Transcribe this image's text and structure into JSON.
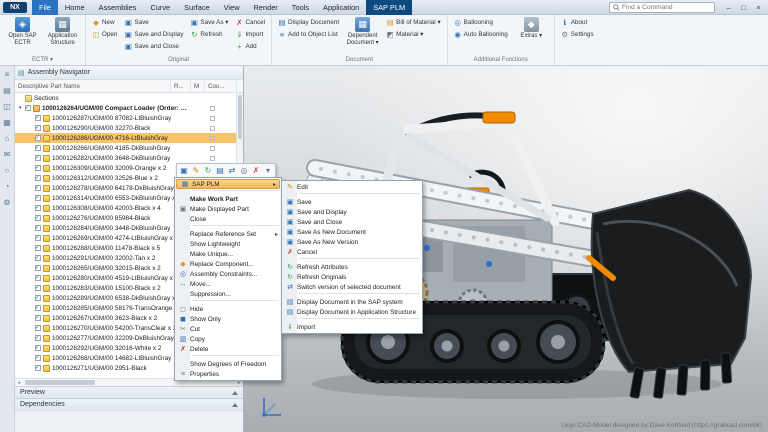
{
  "titlebar": {
    "logo": "NX",
    "search_placeholder": "Find a Command",
    "window_controls": {
      "minimize": "–",
      "restore": "□",
      "close": "×"
    },
    "tabs": [
      {
        "label": "File",
        "file": true
      },
      {
        "label": "Home"
      },
      {
        "label": "Assemblies"
      },
      {
        "label": "Curve"
      },
      {
        "label": "Surface"
      },
      {
        "label": "View"
      },
      {
        "label": "Render"
      },
      {
        "label": "Tools"
      },
      {
        "label": "Application"
      },
      {
        "label": "SAP PLM",
        "active": true
      }
    ]
  },
  "ribbon": {
    "groups": [
      {
        "label": "ECTR ▾"
      },
      {
        "label": "Original"
      },
      {
        "label": "Document"
      },
      {
        "label": "Additional Functions"
      },
      {
        "label": ""
      }
    ],
    "buttons": {
      "open_sap_ectr": "Open SAP ECTR",
      "application_structure": "Application Structure",
      "new": "New",
      "open": "Open",
      "save": "Save",
      "save_and_display": "Save and Display",
      "save_and_close": "Save and Close",
      "save_as": "Save As ▾",
      "refresh": "Refresh",
      "cancel": "Cancel",
      "import": "Import",
      "add": "Add",
      "display_document": "Display Document",
      "add_to_object_list": "Add to Object List",
      "dependent_document": "Dependent Document ▾",
      "bill_of_material": "Bill of Material ▾",
      "material": "Material ▾",
      "ballooning": "Ballooning",
      "auto_ballooning": "Auto Ballooning",
      "extras": "Extras ▾",
      "about": "About",
      "settings": "Settings"
    },
    "glyphs": {
      "open_sap_ectr": "◈",
      "application_structure": "▦",
      "dependent_document": "▦",
      "extras": "◆",
      "new": "◆",
      "open": "◫",
      "save": "▣",
      "save_and_display": "▣",
      "save_and_close": "▣",
      "save_as": "▣",
      "refresh": "↻",
      "cancel": "✗",
      "import": "⇓",
      "add": "+",
      "display_document": "▤",
      "add_to_object_list": "≡",
      "bill_of_material": "▤",
      "material": "◩",
      "ballooning": "◎",
      "auto_ballooning": "◉",
      "about": "ℹ",
      "settings": "⚙"
    }
  },
  "resource_bar": {
    "icons": [
      {
        "glyph": "≡",
        "name": "menu-icon"
      },
      {
        "glyph": "▤",
        "name": "assembly-navigator-icon"
      },
      {
        "glyph": "◫",
        "name": "constraint-navigator-icon"
      },
      {
        "glyph": "▦",
        "name": "part-navigator-icon"
      },
      {
        "glyph": "⌂",
        "name": "home-icon"
      },
      {
        "glyph": "✉",
        "name": "notes-icon"
      },
      {
        "glyph": "○",
        "name": "reuse-library-icon"
      },
      {
        "glyph": "◔",
        "name": "history-icon"
      },
      {
        "glyph": "⚙",
        "name": "roles-icon"
      }
    ]
  },
  "navigator": {
    "title": "Assembly Navigator",
    "columns": [
      "Descriptive Part Name",
      "R...",
      "M",
      "Cou..."
    ],
    "preview_label": "Preview",
    "dependencies_label": "Dependencies",
    "rows": [
      {
        "label": "Sections",
        "folder": true
      },
      {
        "label": "1000126264/UGM/00 Compact Loader (Order: C...",
        "asm": true,
        "bold": true,
        "exp": "▾",
        "chk": true
      },
      {
        "label": "1000126287/UGM/00 87082-LtBluishGray",
        "child": true,
        "chk": true
      },
      {
        "label": "1000126290/UGM/00 32270-Black",
        "child": true,
        "chk": true
      },
      {
        "label": "1000126286/UGM/00 4716-LtBluishGray",
        "child": true,
        "chk": true,
        "selected": true
      },
      {
        "label": "1000126266/UGM/00 4185-DkBluishGray",
        "child": true,
        "chk": true
      },
      {
        "label": "1000126282/UGM/00 3648-DkBluishGray",
        "child": true,
        "chk": true
      },
      {
        "label": "1000126309/UGM/00 32009-Orange x 2",
        "child": true,
        "chk": true
      },
      {
        "label": "1000126312/UGM/00 32526-Blue x 2",
        "child": true,
        "chk": true
      },
      {
        "label": "1000126278/UGM/00 64178-DkBluishGray x 2",
        "child": true,
        "chk": true
      },
      {
        "label": "1000126314/UGM/00 6553-DkBluishGray x 2",
        "child": true,
        "chk": true
      },
      {
        "label": "1000126308/UGM/00 42003-Black x 4",
        "child": true,
        "chk": true
      },
      {
        "label": "1000126276/UGM/00 85984-Black",
        "child": true,
        "chk": true
      },
      {
        "label": "1000126284/UGM/00 3448-DkBluishGray",
        "child": true,
        "chk": true
      },
      {
        "label": "1000126269/UGM/00 4274-LtBluishGray x 5",
        "child": true,
        "chk": true
      },
      {
        "label": "1000126288/UGM/00 11478-Black x 5",
        "child": true,
        "chk": true
      },
      {
        "label": "1000126291/UGM/00 32002-Tan x 2",
        "child": true,
        "chk": true
      },
      {
        "label": "1000126265/UGM/00 32015-Black x 2",
        "child": true,
        "chk": true
      },
      {
        "label": "1000126280/UGM/00 4519-LtBluishGray x 5",
        "child": true,
        "chk": true
      },
      {
        "label": "1000126283/UGM/00 15100-Black x 2",
        "child": true,
        "chk": true
      },
      {
        "label": "1000126289/UGM/00 6538-DkBluishGray x 2",
        "child": true,
        "chk": true
      },
      {
        "label": "1000126285/UGM/00 58176-TransOrange",
        "child": true,
        "chk": true
      },
      {
        "label": "1000126267/UGM/00 3623-Black x 2",
        "child": true,
        "chk": true
      },
      {
        "label": "1000126270/UGM/00 54200-TransClear x 3",
        "child": true,
        "chk": true
      },
      {
        "label": "1000126277/UGM/00 32209-DkBluishGray x 2",
        "child": true,
        "chk": true
      },
      {
        "label": "1000126292/UGM/00 32016-White x 2",
        "child": true,
        "chk": true
      },
      {
        "label": "1000126268/UGM/00 14682-LtBluishGray",
        "child": true,
        "chk": true
      },
      {
        "label": "1000126271/UGM/00 2951-Black",
        "child": true,
        "chk": true
      }
    ]
  },
  "mini_toolbar": {
    "icons": [
      {
        "glyph": "▣",
        "name": "save-icon",
        "glyph_color": "#2f6fb4"
      },
      {
        "glyph": "✎",
        "name": "edit-icon",
        "glyph_color": "#c08a00"
      },
      {
        "glyph": "↻",
        "name": "refresh-icon",
        "glyph_color": "#3f9d4e"
      },
      {
        "glyph": "▤",
        "name": "display-document-icon",
        "glyph_color": "#2f6fb4"
      },
      {
        "glyph": "⇄",
        "name": "switch-version-icon",
        "glyph_color": "#2f6fb4"
      },
      {
        "glyph": "◎",
        "name": "constraints-icon",
        "glyph_color": "#6d7884"
      },
      {
        "glyph": "✗",
        "name": "cancel-icon",
        "glyph_color": "#cc3b33"
      },
      {
        "glyph": "▾",
        "name": "more-icon",
        "glyph_color": "#6d7884"
      }
    ]
  },
  "context_menu": {
    "items": [
      {
        "label": "SAP PLM",
        "glyph": "▦",
        "glyph_color": "#2f6fb4",
        "arrow": "▸",
        "selected": true
      },
      {
        "sep": true
      },
      {
        "label": "Make Work Part",
        "bold": true
      },
      {
        "label": "Make Displayed Part",
        "glyph": "▣",
        "glyph_color": "#6d7884"
      },
      {
        "label": "Close"
      },
      {
        "sep": true
      },
      {
        "label": "Replace Reference Set",
        "arrow": "▸"
      },
      {
        "label": "Show Lightweight"
      },
      {
        "label": "Make Unique..."
      },
      {
        "label": "Replace Component...",
        "glyph": "◆",
        "glyph_color": "#d89a2b"
      },
      {
        "label": "Assembly Constraints...",
        "glyph": "◎",
        "glyph_color": "#2f6fb4"
      },
      {
        "label": "Move...",
        "glyph": "↔",
        "glyph_color": "#3f9d4e"
      },
      {
        "label": "Suppression..."
      },
      {
        "sep": true
      },
      {
        "label": "Hide",
        "glyph": "◻",
        "glyph_color": "#6d7884"
      },
      {
        "label": "Show Only",
        "glyph": "◼",
        "glyph_color": "#2f6fb4"
      },
      {
        "label": "Cut",
        "glyph": "✂",
        "glyph_color": "#6d7884"
      },
      {
        "label": "Copy",
        "glyph": "▥",
        "glyph_color": "#2f6fb4"
      },
      {
        "label": "Delete",
        "glyph": "✗",
        "glyph_color": "#cc3b33"
      },
      {
        "sep": true
      },
      {
        "label": "Show Degrees of Freedom"
      },
      {
        "label": "Properties",
        "glyph": "≡",
        "glyph_color": "#6d7884"
      }
    ]
  },
  "sap_submenu": {
    "items": [
      {
        "label": "Edit",
        "glyph": "✎",
        "glyph_color": "#c08a00"
      },
      {
        "sep": true
      },
      {
        "label": "Save",
        "glyph": "▣",
        "glyph_color": "#2f6fb4"
      },
      {
        "label": "Save and Display",
        "glyph": "▣",
        "glyph_color": "#2f6fb4"
      },
      {
        "label": "Save and Close",
        "glyph": "▣",
        "glyph_color": "#2f6fb4"
      },
      {
        "label": "Save As New Document",
        "glyph": "▣",
        "glyph_color": "#2f6fb4"
      },
      {
        "label": "Save As New Version",
        "glyph": "▣",
        "glyph_color": "#2f6fb4"
      },
      {
        "label": "Cancel",
        "glyph": "✗",
        "glyph_color": "#cc3b33"
      },
      {
        "sep": true
      },
      {
        "label": "Refresh Attributes",
        "glyph": "↻",
        "glyph_color": "#3f9d4e"
      },
      {
        "label": "Refresh Originals",
        "glyph": "↻",
        "glyph_color": "#3f9d4e"
      },
      {
        "label": "Switch version of selected document",
        "glyph": "⇄",
        "glyph_color": "#2f6fb4"
      },
      {
        "sep": true
      },
      {
        "label": "Display Document in the SAP system",
        "glyph": "▤",
        "glyph_color": "#2f6fb4"
      },
      {
        "label": "Display Document in Application Structure",
        "glyph": "▤",
        "glyph_color": "#2f6fb4"
      },
      {
        "sep": true
      },
      {
        "label": "Import",
        "glyph": "⇓",
        "glyph_color": "#3f9d4e"
      }
    ]
  },
  "viewport": {
    "credit": "Lego CAD-Model designed by Dave Kohfield (https://grabcad.com/dk)"
  }
}
